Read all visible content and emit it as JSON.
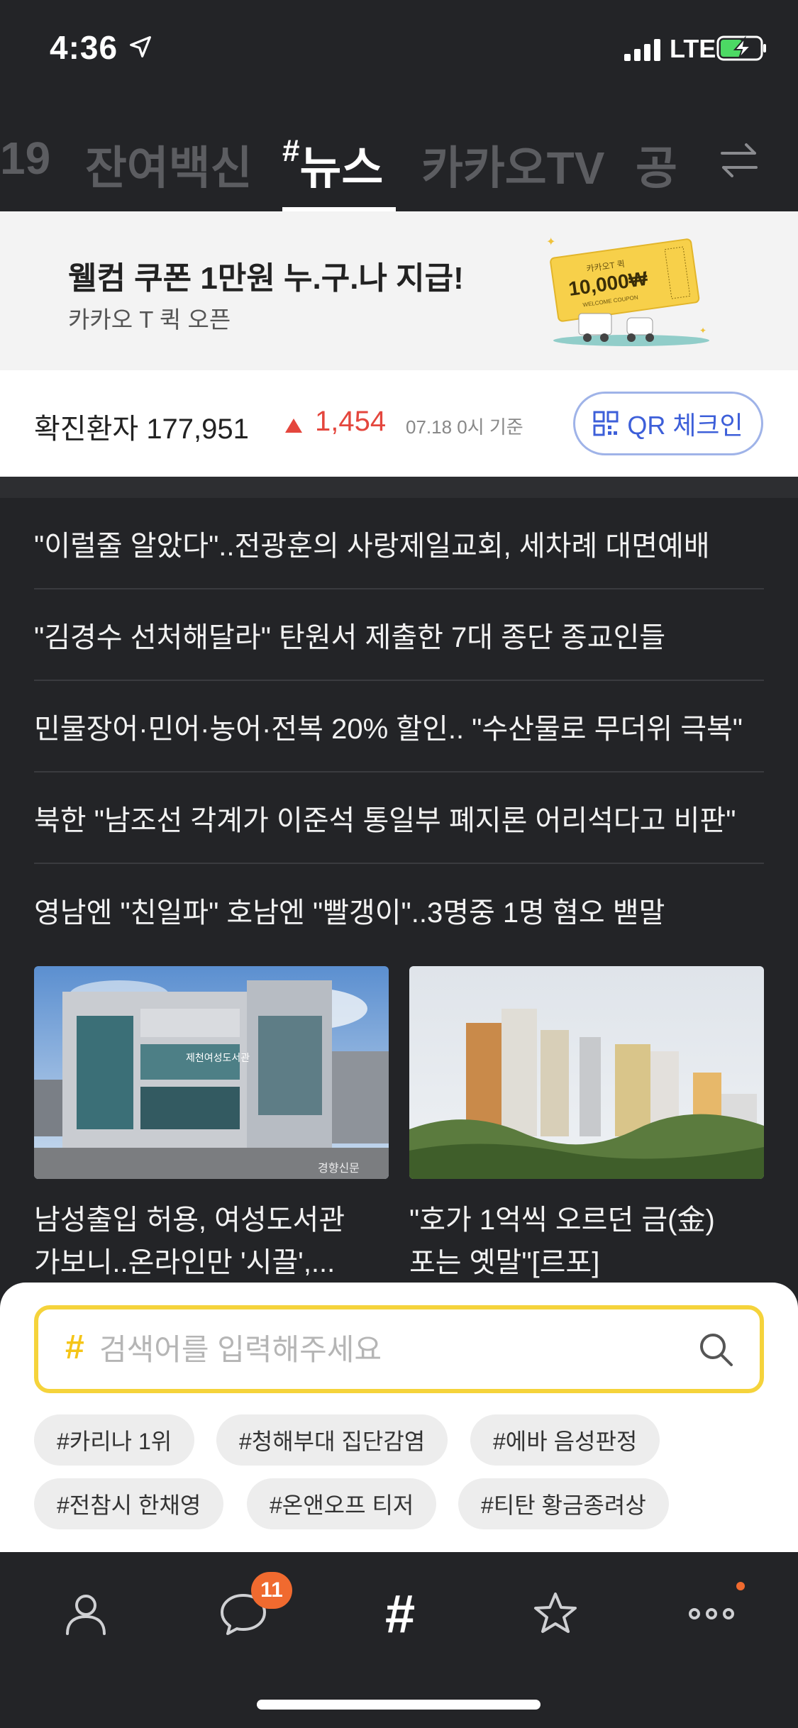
{
  "status_bar": {
    "time": "4:36",
    "network": "LTE"
  },
  "tabs": [
    {
      "label": "19"
    },
    {
      "label": "잔여백신"
    },
    {
      "label": "뉴스",
      "prefix": "#"
    },
    {
      "label": "카카오TV"
    },
    {
      "label": "공"
    }
  ],
  "banner": {
    "headline": "웰컴 쿠폰 1만원 누.구.나 지급!",
    "subtitle": "카카오 T 퀵 오픈",
    "coupon_top": "카카오T 퀵",
    "coupon_amount": "10,000₩",
    "coupon_bottom": "WELCOME COUPON"
  },
  "covid": {
    "label": "확진환자 177,951",
    "increase": "1,454",
    "date": "07.18 0시 기준",
    "qr_button": "QR 체크인"
  },
  "headlines": [
    "\"이럴줄 알았다\"..전광훈의 사랑제일교회, 세차례 대면예배",
    "\"김경수 선처해달라\" 탄원서 제출한 7대 종단 종교인들",
    "민물장어·민어·농어·전복 20% 할인.. \"수산물로 무더위 극복\"",
    "북한 \"남조선 각계가 이준석 통일부 폐지론 어리석다고 비판\"",
    "영남엔 \"친일파\" 호남엔 \"빨갱이\"..3명중 1명 혐오 밷말"
  ],
  "cards": [
    {
      "caption_line1": "남성출입 허용, 여성도서관",
      "caption_line2": "가보니..온라인만 '시끌',...",
      "watermark": "경향신문",
      "sign": "제천여성도서관"
    },
    {
      "caption_line1": "\"호가 1억씩 오르던 금(金)",
      "caption_line2": "포는 옛말\"[르포]"
    }
  ],
  "search": {
    "hash": "#",
    "placeholder": "검색어를 입력해주세요"
  },
  "chips": [
    "#카리나 1위",
    "#청해부대 집단감염",
    "#에바 음성판정",
    "#전참시 한채영",
    "#온앤오프 티저",
    "#티탄 황금종려상"
  ],
  "nav": {
    "chat_badge": "11",
    "hash_label": "#"
  },
  "colors": {
    "accent_yellow": "#f5d33b",
    "badge_orange": "#f06a2f",
    "increase_red": "#e4463d",
    "qr_blue": "#3d5fd9"
  }
}
